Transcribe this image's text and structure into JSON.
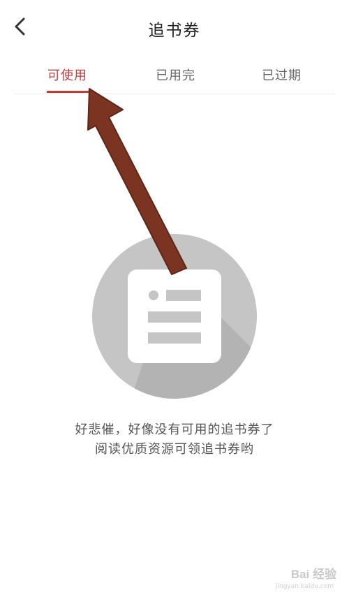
{
  "header": {
    "title": "追书券",
    "back_icon": "chevron-left-icon"
  },
  "tabs": [
    {
      "label": "可使用",
      "active": true
    },
    {
      "label": "已用完",
      "active": false
    },
    {
      "label": "已过期",
      "active": false
    }
  ],
  "empty_state": {
    "line1": "好悲催，好像没有可用的追书券了",
    "line2": "阅读优质资源可领追书券哟",
    "icon": "document-list-icon"
  },
  "annotation": {
    "icon": "arrow-pointer-icon"
  },
  "watermark": {
    "text": "Bai 经验",
    "sub": "jingyan.baidu.com"
  },
  "colors": {
    "accent": "#c0393b",
    "arrow": "#7b3422",
    "circle": "#c5c5c5"
  }
}
